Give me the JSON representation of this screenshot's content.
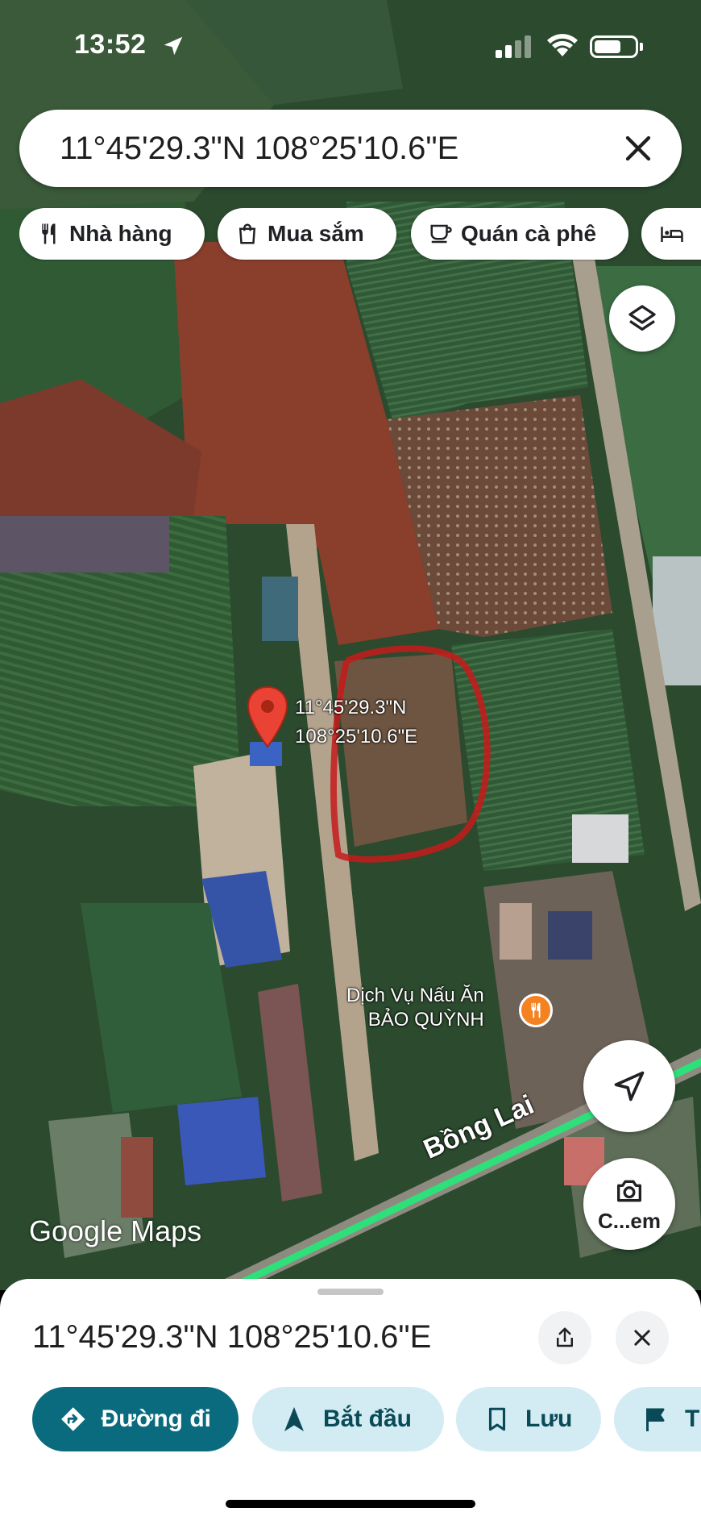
{
  "status_bar": {
    "time": "13:52"
  },
  "search": {
    "query": "11°45'29.3\"N 108°25'10.6\"E"
  },
  "chips": [
    {
      "label": "Nhà hàng",
      "icon": "fork-knife-icon"
    },
    {
      "label": "Mua sắm",
      "icon": "shopping-bag-icon"
    },
    {
      "label": "Quán cà phê",
      "icon": "coffee-cup-icon"
    },
    {
      "label": "",
      "icon": "bed-icon"
    }
  ],
  "map": {
    "pin": {
      "lat": "11°45'29.3\"N",
      "lng": "108°25'10.6\"E"
    },
    "poi": {
      "line1": "Dịch Vụ Nấu Ăn",
      "line2": "BẢO QUỲNH",
      "icon": "restaurant-icon",
      "color": "#f58220"
    },
    "road": "Bồng Lai",
    "watermark": "Google Maps",
    "camera_button": "C...em"
  },
  "sheet": {
    "title": "11°45'29.3\"N 108°25'10.6\"E",
    "actions": [
      {
        "label": "Đường đi",
        "icon": "directions-icon"
      },
      {
        "label": "Bắt đầu",
        "icon": "navigation-arrow-icon"
      },
      {
        "label": "Lưu",
        "icon": "bookmark-icon"
      },
      {
        "label": "T",
        "icon": "flag-icon"
      }
    ]
  },
  "colors": {
    "primary": "#0b6b7e",
    "tonal": "#d3ecf3",
    "pin": "#ea4335",
    "road": "#2ee07a"
  }
}
